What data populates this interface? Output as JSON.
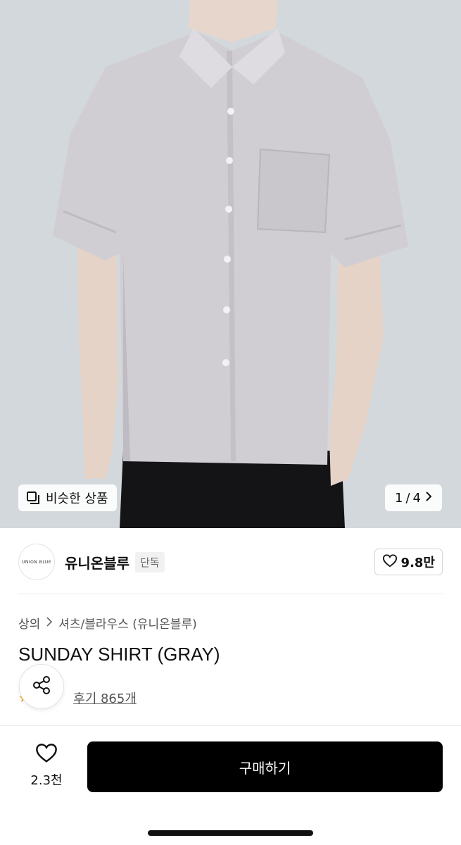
{
  "similar_products": {
    "label": "비슷한 상품",
    "icon": "similar-products-icon"
  },
  "image_counter": {
    "current": "1",
    "separator": "/",
    "total": "4",
    "icon": "chevron-right-icon"
  },
  "brand": {
    "logo_text": "UNION BLUE",
    "name": "유니온블루",
    "tag": "단독",
    "like_count": "9.8만",
    "like_icon": "heart-outline-icon"
  },
  "breadcrumb": {
    "category": "상의",
    "subcategory": "셔츠/블라우스 (유니온블루)"
  },
  "product": {
    "title": "SUNDAY SHIRT (GRAY)"
  },
  "reviews": {
    "label": "후기 865개",
    "star_icon": "star-icon"
  },
  "share": {
    "icon": "share-icon"
  },
  "bottom_bar": {
    "wish_count": "2.3천",
    "wish_icon": "heart-outline-icon",
    "buy_label": "구매하기"
  },
  "colors": {
    "accent": "#000000",
    "star": "#f2a51e",
    "shirt": "#d0ced2"
  }
}
